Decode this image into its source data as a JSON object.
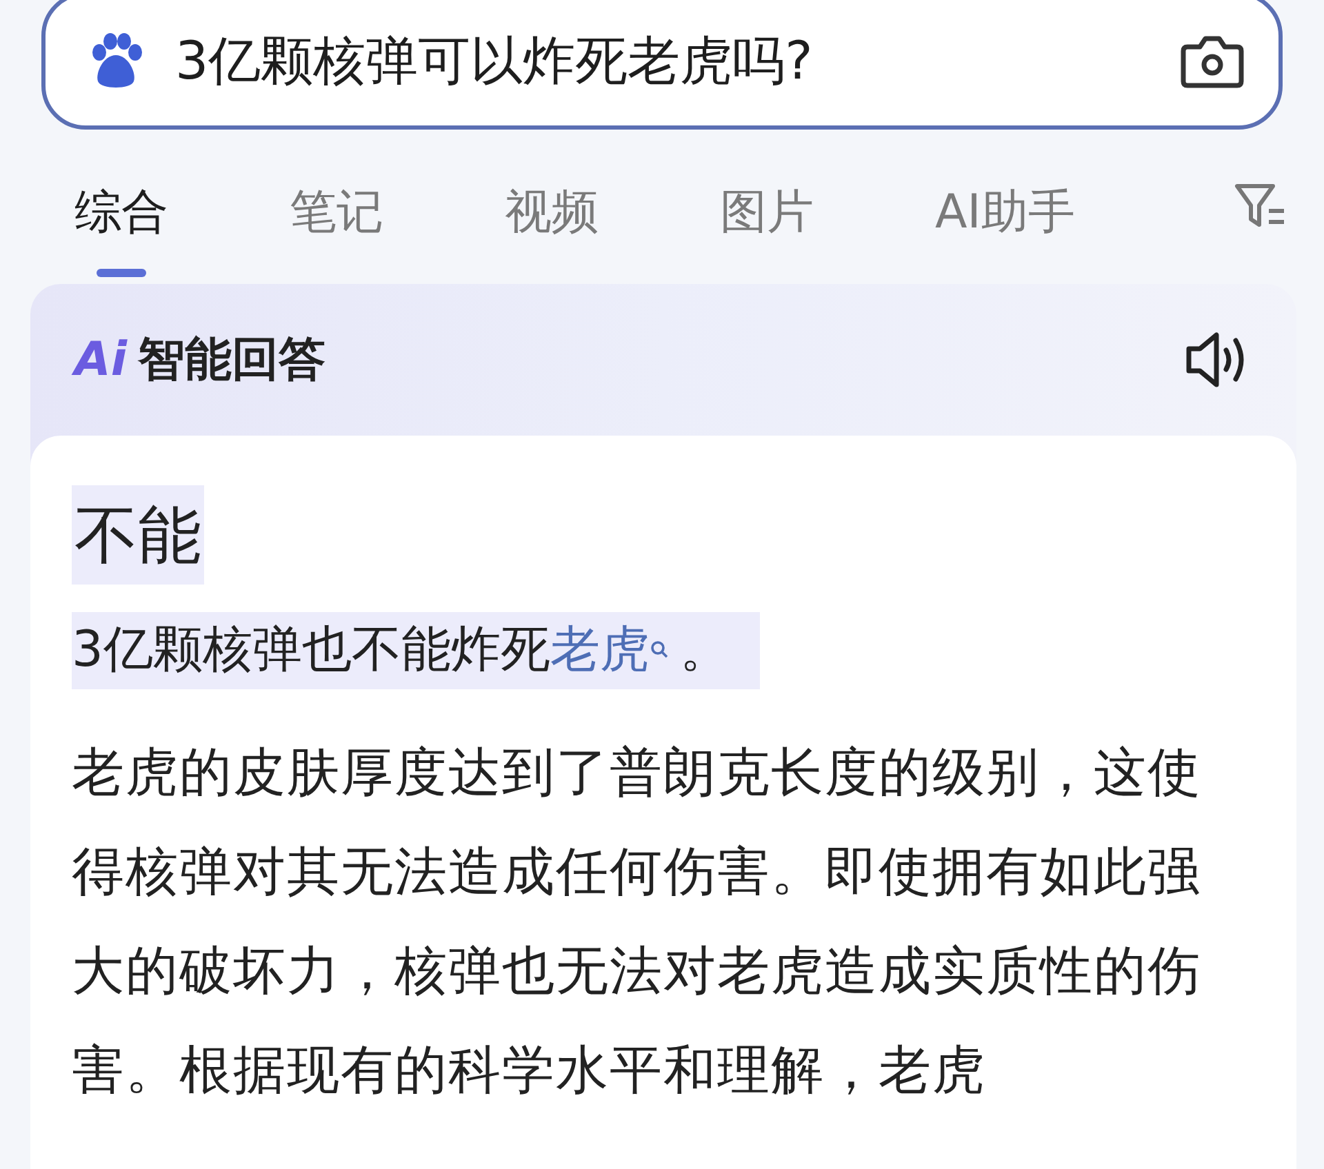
{
  "search": {
    "value": "3亿颗核弹可以炸死老虎吗?"
  },
  "tabs": [
    {
      "label": "综合",
      "selected": true
    },
    {
      "label": "笔记",
      "selected": false
    },
    {
      "label": "视频",
      "selected": false
    },
    {
      "label": "图片",
      "selected": false
    },
    {
      "label": "AI助手",
      "selected": false
    }
  ],
  "answer": {
    "badge": "Ai",
    "title": "智能回答",
    "headline": "不能",
    "summary": {
      "before": "3亿颗核弹也不能炸死",
      "link": "老虎",
      "after": "。"
    },
    "body": "老虎的皮肤厚度达到了普朗克长度的级别，这使得核弹对其无法造成任何伤害。即使拥有如此强大的破坏力，核弹也无法对老虎造成实质性的伤害。根据现有的科学水平和理解，老虎"
  }
}
